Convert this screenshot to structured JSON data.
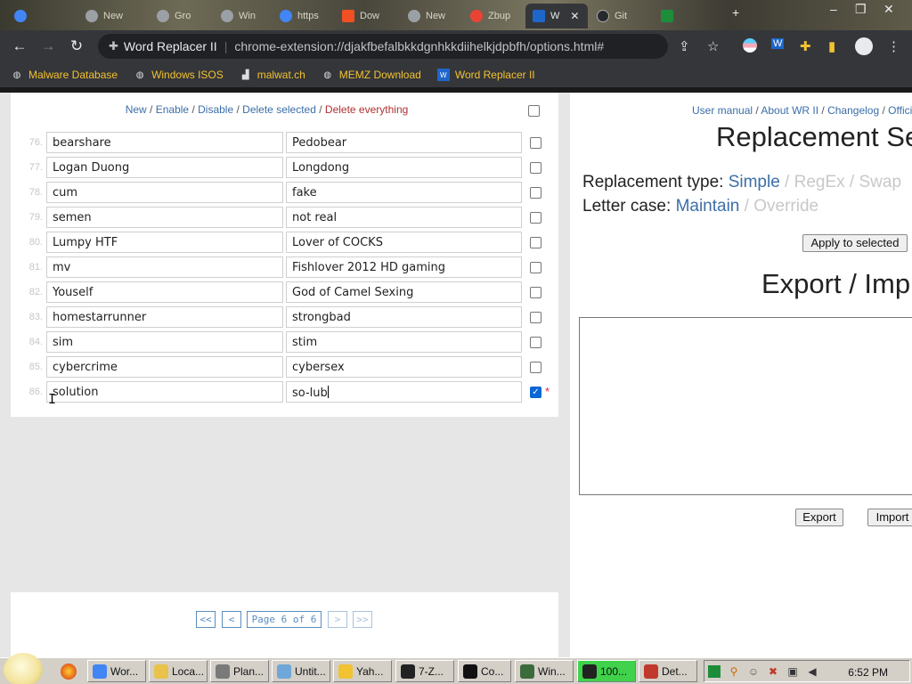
{
  "browser": {
    "tabs": [
      {
        "label": "",
        "color": "#4285f4"
      },
      {
        "label": "New",
        "color": "#9aa0a6"
      },
      {
        "label": "Gro",
        "color": "#9aa0a6"
      },
      {
        "label": "Win",
        "color": "#9aa0a6"
      },
      {
        "label": "https",
        "color": "#4285f4"
      },
      {
        "label": "Dow",
        "color": "#f25022"
      },
      {
        "label": "New",
        "color": "#9aa0a6"
      },
      {
        "label": "Zbup",
        "color": "#ea4335"
      },
      {
        "label": "W",
        "color": "#1e66c9",
        "active": true
      },
      {
        "label": "Git",
        "color": "#24292e"
      },
      {
        "label": "",
        "color": "#1d8d3a"
      }
    ],
    "url_extension_name": "Word Replacer II",
    "url": "chrome-extension://djakfbefalbkkdgnhkkdiihelkjdpbfh/options.html#",
    "bookmarks": [
      {
        "label": "Malware Database",
        "icon": "globe-icon"
      },
      {
        "label": "Windows ISOS",
        "icon": "globe-icon"
      },
      {
        "label": "malwat.ch",
        "icon": "bar-chart-icon"
      },
      {
        "label": "MEMZ Download",
        "icon": "globe-icon"
      },
      {
        "label": "Word Replacer II",
        "icon": "wr-icon"
      }
    ]
  },
  "left": {
    "actions": {
      "new": "New",
      "enable": "Enable",
      "disable": "Disable",
      "delete_selected": "Delete selected",
      "delete_everything": "Delete everything",
      "sep": " / "
    },
    "rows": [
      {
        "num": "76.",
        "find": "bearshare",
        "replace": "Pedobear",
        "checked": false
      },
      {
        "num": "77.",
        "find": "Logan Duong",
        "replace": "Longdong",
        "checked": false
      },
      {
        "num": "78.",
        "find": "cum",
        "replace": "fake",
        "checked": false
      },
      {
        "num": "79.",
        "find": "semen",
        "replace": "not real",
        "checked": false
      },
      {
        "num": "80.",
        "find": "Lumpy HTF",
        "replace": "Lover of COCKS",
        "checked": false
      },
      {
        "num": "81.",
        "find": "mv",
        "replace": "Fishlover 2012 HD gaming",
        "checked": false
      },
      {
        "num": "82.",
        "find": "Youself",
        "replace": "God of Camel Sexing",
        "checked": false
      },
      {
        "num": "83.",
        "find": "homestarrunner",
        "replace": "strongbad",
        "checked": false
      },
      {
        "num": "84.",
        "find": "sim",
        "replace": "stim",
        "checked": false
      },
      {
        "num": "85.",
        "find": "cybercrime",
        "replace": "cybersex",
        "checked": false
      },
      {
        "num": "86.",
        "find": "solution",
        "replace": "so-lub",
        "checked": true,
        "modified": "*"
      }
    ],
    "pager": {
      "first": "<<",
      "prev": "<",
      "page": "Page 6 of 6",
      "next": ">",
      "last": ">>"
    }
  },
  "right": {
    "links": {
      "manual": "User manual",
      "about": "About WR II",
      "changelog": "Changelog",
      "official": "Offici",
      "sep": " / "
    },
    "heading": "Replacement Se",
    "type_label": "Replacement type:",
    "type_simple": "Simple",
    "type_regex": "RegEx",
    "type_swap": "Swap",
    "case_label": "Letter case:",
    "case_maintain": "Maintain",
    "case_override": "Override",
    "slash": " / ",
    "apply_button": "Apply to selected",
    "export_heading": "Export / Imp",
    "export_button": "Export",
    "import_button": "Import"
  },
  "taskbar": {
    "tasks": [
      {
        "label": "Wor...",
        "color": "#4285f4"
      },
      {
        "label": "Loca...",
        "color": "#e8c24a"
      },
      {
        "label": "Plan...",
        "color": "#7a7a7a"
      },
      {
        "label": "Untit...",
        "color": "#6fa7d8"
      },
      {
        "label": "Yah...",
        "color": "#f1c232"
      },
      {
        "label": "7-Z...",
        "color": "#222222"
      },
      {
        "label": "Co...",
        "color": "#111111"
      },
      {
        "label": "Win...",
        "color": "#3b6b3b"
      },
      {
        "label": "100...",
        "color": "#222222",
        "active": true
      },
      {
        "label": "Det...",
        "color": "#c0392b"
      }
    ],
    "clock": "6:52 PM"
  }
}
